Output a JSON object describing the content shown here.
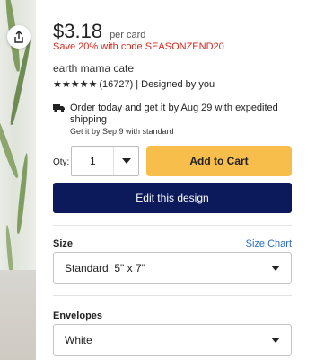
{
  "product": {
    "price": "$3.18",
    "price_unit": "per card",
    "promo": "Save 20% with code SEASONZEND20",
    "seller": "earth mama cate",
    "rating_stars": "★★★★★",
    "review_count": "(16727)",
    "designed_by": "| Designed by you"
  },
  "shipping": {
    "line1_prefix": "Order today and get it by ",
    "line1_date": "Aug 29",
    "line1_suffix": " with expedited shipping",
    "line2": "Get it by Sep 9 with standard"
  },
  "purchase": {
    "qty_label": "Qty:",
    "qty_value": "1",
    "add_to_cart": "Add to Cart",
    "edit_design": "Edit this design"
  },
  "options": {
    "size_label": "Size",
    "size_chart": "Size Chart",
    "size_value": "Standard, 5\" x 7\"",
    "envelopes_label": "Envelopes",
    "envelopes_value": "White"
  },
  "icons": {
    "share": "share-icon",
    "truck": "truck-icon",
    "caret": "caret-down-icon"
  },
  "colors": {
    "promo": "#d7261e",
    "add_to_cart": "#f7be4b",
    "edit_design": "#0c1a5c",
    "link": "#2b6cc4"
  }
}
